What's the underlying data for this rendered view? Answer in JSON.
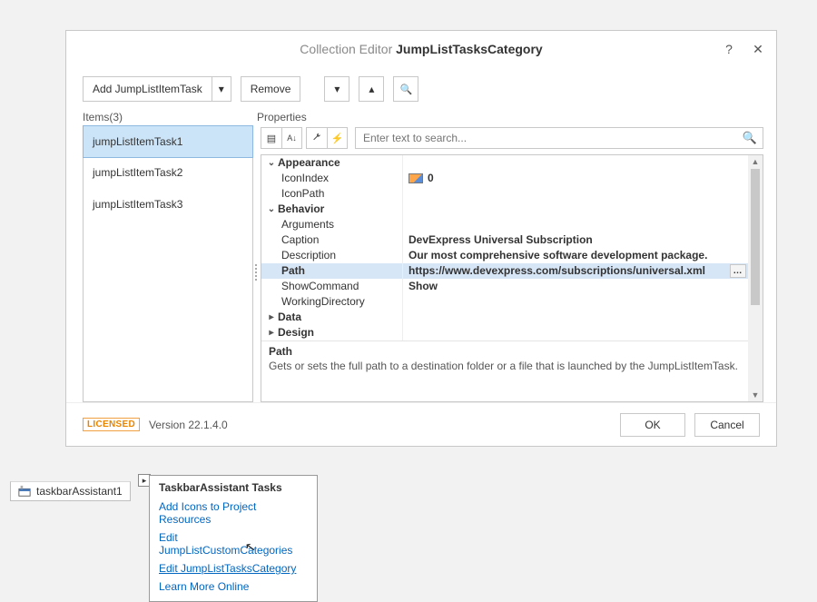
{
  "dialog": {
    "title_prefix": "Collection Editor",
    "title_main": "JumpListTasksCategory"
  },
  "toolbar": {
    "add_label": "Add JumpListItemTask",
    "remove_label": "Remove"
  },
  "labels": {
    "items": "Items(3)",
    "properties": "Properties"
  },
  "items": [
    {
      "label": "jumpListItemTask1",
      "selected": true
    },
    {
      "label": "jumpListItemTask2",
      "selected": false
    },
    {
      "label": "jumpListItemTask3",
      "selected": false
    }
  ],
  "search": {
    "placeholder": "Enter text to search..."
  },
  "grid": {
    "categories": [
      {
        "name": "Appearance",
        "expanded": true,
        "props": [
          {
            "name": "IconIndex",
            "value": "0",
            "icon": true
          },
          {
            "name": "IconPath",
            "value": ""
          }
        ]
      },
      {
        "name": "Behavior",
        "expanded": true,
        "props": [
          {
            "name": "Arguments",
            "value": ""
          },
          {
            "name": "Caption",
            "value": "DevExpress Universal Subscription",
            "bold": true
          },
          {
            "name": "Description",
            "value": "Our most comprehensive software development package.",
            "bold": true
          },
          {
            "name": "Path",
            "value": "https://www.devexpress.com/subscriptions/universal.xml",
            "bold": true,
            "selected": true,
            "ellipsis": true
          },
          {
            "name": "ShowCommand",
            "value": "Show",
            "bold": true
          },
          {
            "name": "WorkingDirectory",
            "value": ""
          }
        ]
      },
      {
        "name": "Data",
        "expanded": false,
        "props": []
      },
      {
        "name": "Design",
        "expanded": false,
        "props": []
      }
    ]
  },
  "description": {
    "prop": "Path",
    "text": "Gets or sets the full path to a destination folder or a file that is launched by the JumpListItemTask."
  },
  "footer": {
    "licensed": "LICENSED",
    "version": "Version 22.1.4.0",
    "ok": "OK",
    "cancel": "Cancel"
  },
  "tray": {
    "component": "taskbarAssistant1"
  },
  "smarttag": {
    "title": "TaskbarAssistant Tasks",
    "links": [
      "Add Icons to Project Resources",
      "Edit JumpListCustomCategories",
      "Edit JumpListTasksCategory",
      "Learn More Online"
    ],
    "selected_index": 2
  }
}
